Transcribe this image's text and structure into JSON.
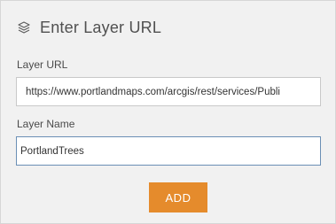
{
  "header": {
    "icon": "layers-icon",
    "title": "Enter Layer URL"
  },
  "form": {
    "url_label": "Layer URL",
    "url_value": "https://www.portlandmaps.com/arcgis/rest/services/Publi",
    "name_label": "Layer Name",
    "name_value": "PortlandTrees"
  },
  "actions": {
    "add_label": "ADD"
  },
  "colors": {
    "accent": "#e58b2c",
    "focus_border": "#6b8fb5"
  }
}
